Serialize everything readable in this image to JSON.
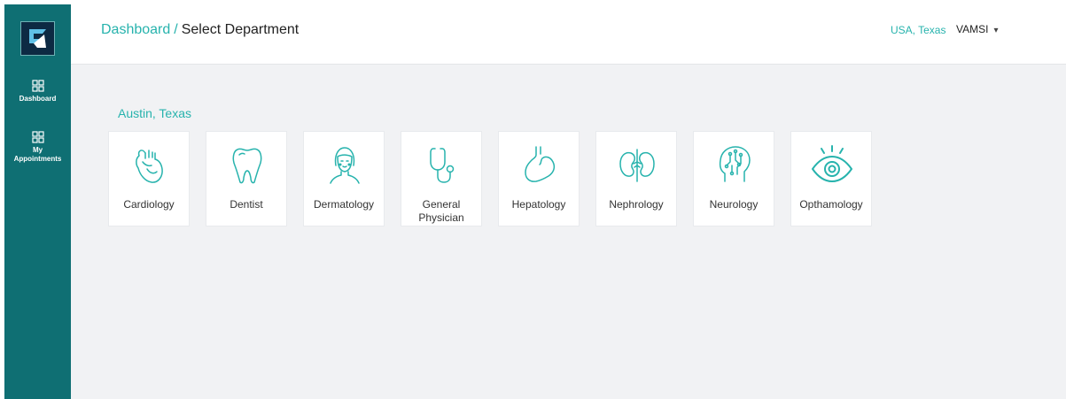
{
  "sidebar": {
    "items": [
      {
        "label": "Dashboard",
        "icon": "grid-icon"
      },
      {
        "label": "My Appointments",
        "line1": "My",
        "line2": "Appointments",
        "icon": "grid-icon"
      }
    ]
  },
  "header": {
    "breadcrumb_link": "Dashboard",
    "breadcrumb_separator": "/",
    "breadcrumb_current": "Select Department",
    "location": "USA, Texas",
    "user_name": "VAMSI"
  },
  "main": {
    "city": "Austin, Texas",
    "departments": [
      {
        "label": "Cardiology",
        "icon": "heart-icon"
      },
      {
        "label": "Dentist",
        "icon": "tooth-icon"
      },
      {
        "label": "Dermatology",
        "icon": "face-icon"
      },
      {
        "label": "General Physician",
        "line1": "General",
        "line2": "Physician",
        "icon": "stethoscope-icon"
      },
      {
        "label": "Hepatology",
        "icon": "stomach-icon"
      },
      {
        "label": "Nephrology",
        "icon": "kidney-icon"
      },
      {
        "label": "Neurology",
        "icon": "brain-icon"
      },
      {
        "label": "Opthamology",
        "icon": "eye-icon"
      }
    ]
  },
  "colors": {
    "sidebar": "#0f6f73",
    "accent": "#27b3ad",
    "background": "#f1f2f4"
  }
}
